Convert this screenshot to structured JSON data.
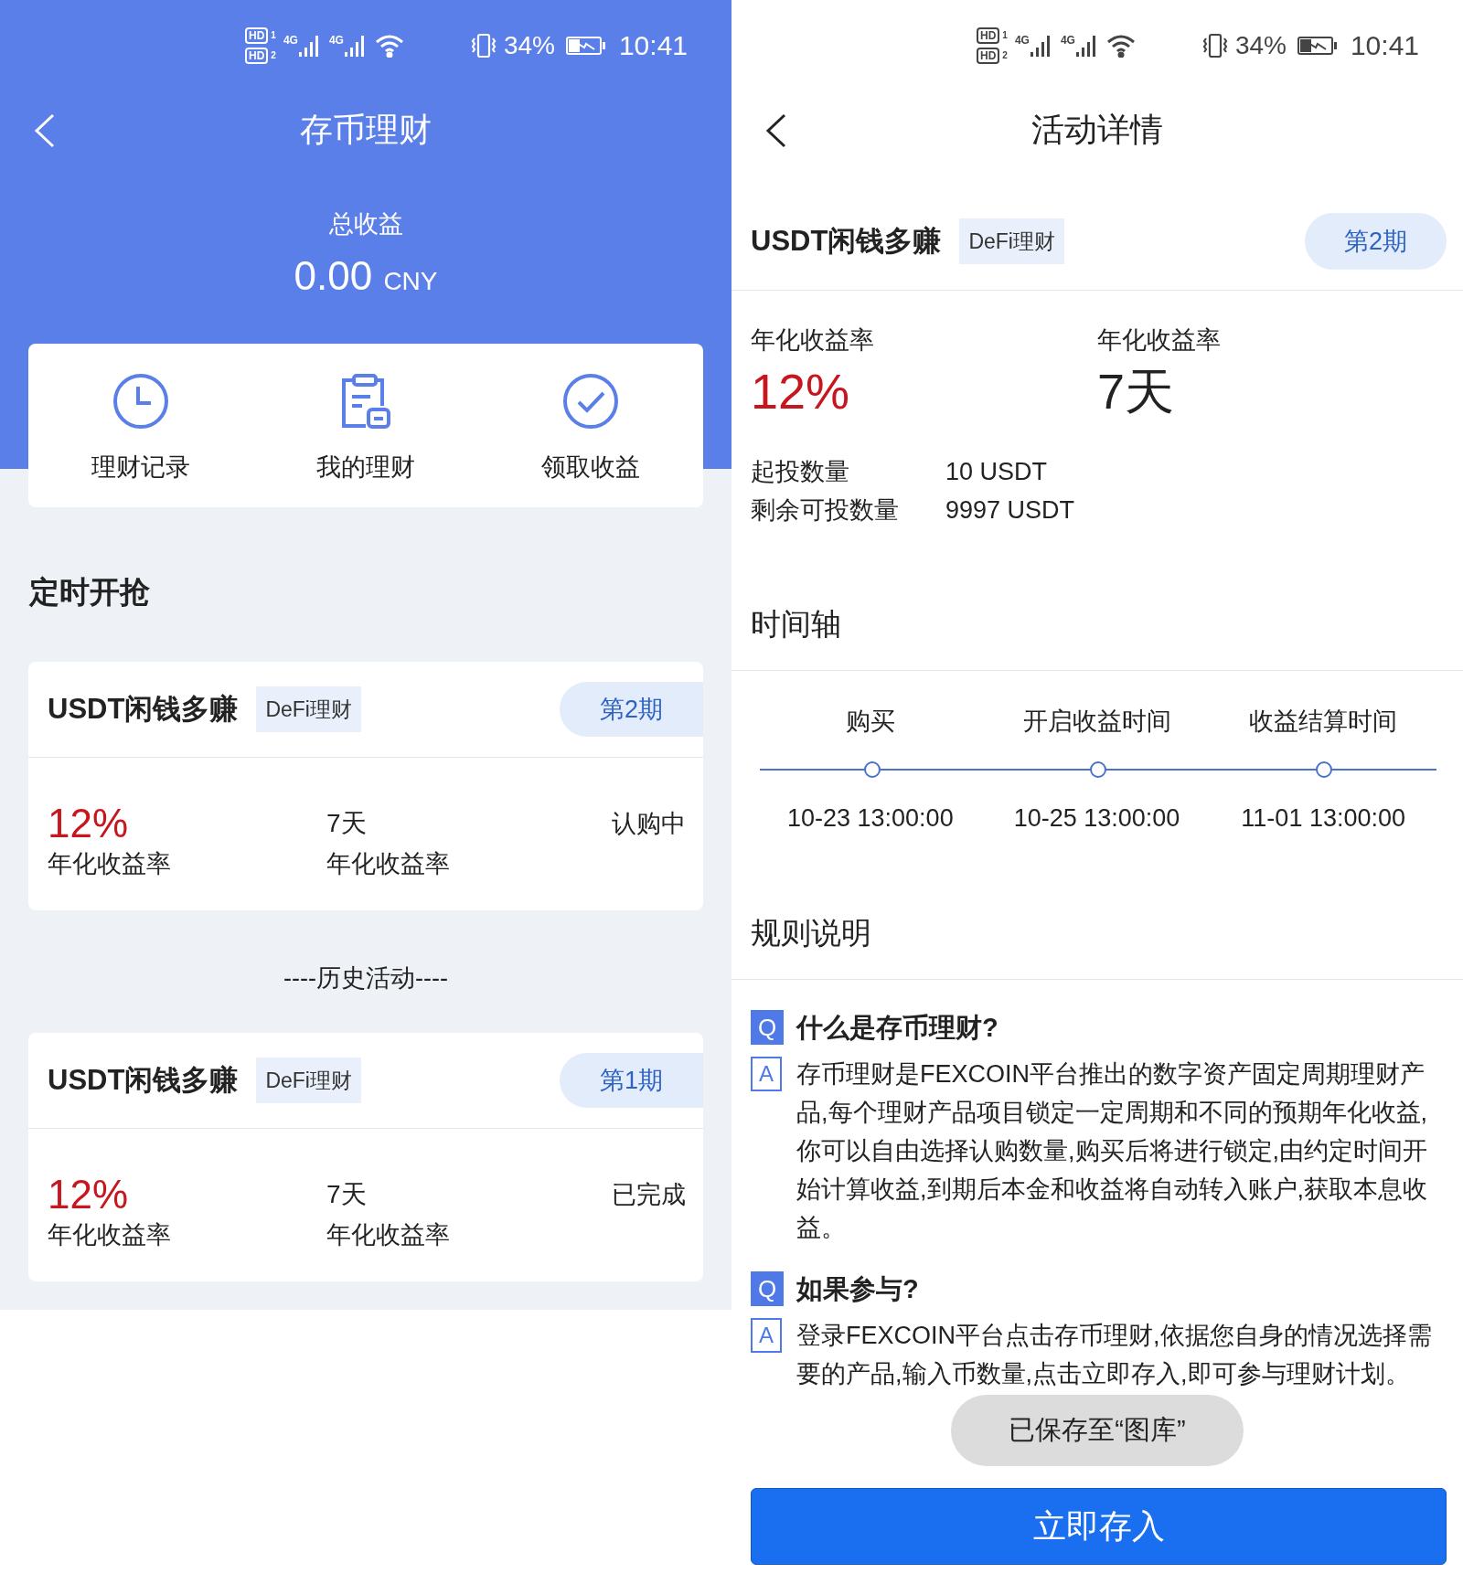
{
  "left": {
    "status_bar": {
      "sims": [
        {
          "label": "HD",
          "slot": "1"
        },
        {
          "label": "HD",
          "slot": "2"
        }
      ],
      "networks": [
        "4G",
        "4G"
      ],
      "battery": "34%",
      "time": "10:41"
    },
    "title": "存币理财",
    "summary": {
      "label": "总收益",
      "amount": "0.00",
      "unit": "CNY"
    },
    "shortcuts": [
      {
        "label": "理财记录",
        "kind": "clock"
      },
      {
        "label": "我的理财",
        "kind": "clipboard"
      },
      {
        "label": "领取收益",
        "kind": "check"
      }
    ],
    "section_title": "定时开抢",
    "products": [
      {
        "name": "USDT闲钱多赚",
        "tag": "DeFi理财",
        "period": "第2期",
        "rate": "12%",
        "rate_label": "年化收益率",
        "duration": "7天",
        "duration_label": "年化收益率",
        "status": "认购中"
      }
    ],
    "history_label": "----历史活动----",
    "history": [
      {
        "name": "USDT闲钱多赚",
        "tag": "DeFi理财",
        "period": "第1期",
        "rate": "12%",
        "rate_label": "年化收益率",
        "duration": "7天",
        "duration_label": "年化收益率",
        "status": "已完成"
      }
    ]
  },
  "right": {
    "status_bar": {
      "sims": [
        {
          "label": "HD",
          "slot": "1"
        },
        {
          "label": "HD",
          "slot": "2"
        }
      ],
      "networks": [
        "4G",
        "4G"
      ],
      "battery": "34%",
      "time": "10:41"
    },
    "title": "活动详情",
    "product": {
      "name": "USDT闲钱多赚",
      "tag": "DeFi理财",
      "period": "第2期"
    },
    "stats": [
      {
        "label": "年化收益率",
        "value": "12%",
        "kind": "rate"
      },
      {
        "label": "年化收益率",
        "value": "7天",
        "kind": "duration"
      }
    ],
    "amounts": [
      {
        "label": "起投数量",
        "value": "10 USDT"
      },
      {
        "label": "剩余可投数量",
        "value": "9997 USDT"
      }
    ],
    "timeline_title": "时间轴",
    "timeline": [
      {
        "label": "购买",
        "time": "10-23 13:00:00"
      },
      {
        "label": "开启收益时间",
        "time": "10-25 13:00:00"
      },
      {
        "label": "收益结算时间",
        "time": "11-01 13:00:00"
      }
    ],
    "rules_title": "规则说明",
    "faqs": [
      {
        "q_mark": "Q",
        "question": "什么是存币理财?",
        "a_mark": "A",
        "answer": "存币理财是FEXCOIN平台推出的数字资产固定周期理财产品,每个理财产品项目锁定一定周期和不同的预期年化收益,你可以自由选择认购数量,购买后将进行锁定,由约定时间开始计算收益,到期后本金和收益将自动转入账户,获取本息收益。"
      },
      {
        "q_mark": "Q",
        "question": "如果参与?",
        "a_mark": "A",
        "answer": "登录FEXCOIN平台点击存币理财,依据您自身的情况选择需要的产品,输入币数量,点击立即存入,即可参与理财计划。"
      }
    ],
    "toast": "已保存至“图库”",
    "button": "立即存入"
  }
}
